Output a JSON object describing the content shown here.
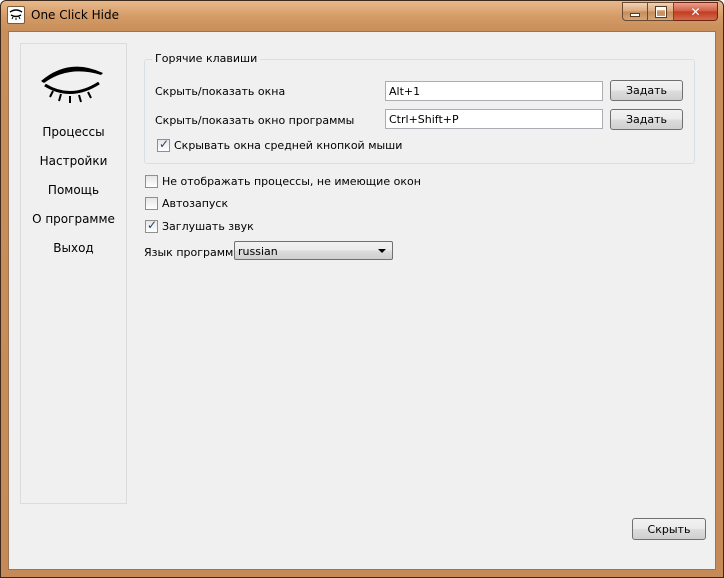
{
  "window": {
    "title": "One Click Hide",
    "icon": "closed-eye-icon",
    "controls": {
      "minimize": "minimize-icon",
      "maximize": "maximize-icon",
      "close": "close-icon"
    }
  },
  "sidebar": {
    "logo": "closed-eye-logo",
    "items": [
      {
        "label": "Процессы"
      },
      {
        "label": "Настройки"
      },
      {
        "label": "Помощь"
      },
      {
        "label": "О программе"
      },
      {
        "label": "Выход"
      }
    ]
  },
  "hotkeys": {
    "title": "Горячие клавиши",
    "rows": [
      {
        "label": "Скрыть/показать окна",
        "value": "Alt+1",
        "button": "Задать"
      },
      {
        "label": "Скрыть/показать окно программы",
        "value": "Ctrl+Shift+P",
        "button": "Задать"
      }
    ],
    "middle_click": {
      "label": "Скрывать окна средней кнопкой мыши",
      "checked": true
    }
  },
  "options": [
    {
      "label": "Не отображать процессы, не имеющие окон",
      "checked": false
    },
    {
      "label": "Автозапуск",
      "checked": false
    },
    {
      "label": "Заглушать звук",
      "checked": true
    }
  ],
  "language": {
    "label": "Язык программы",
    "value": "russian"
  },
  "footer": {
    "hide_button": "Скрыть"
  }
}
